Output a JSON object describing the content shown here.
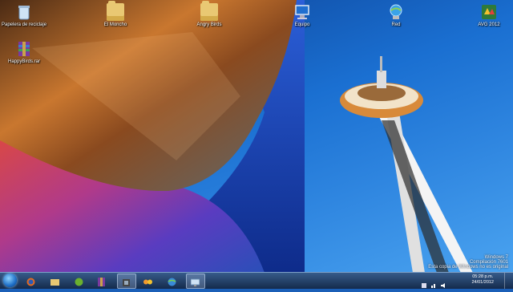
{
  "desktop": {
    "icons": [
      {
        "label": "Papelera de reciclaje",
        "icon": "recycle-bin-icon"
      },
      {
        "label": "El Moncho",
        "icon": "folder-icon"
      },
      {
        "label": "Angry Birds",
        "icon": "folder-icon"
      },
      {
        "label": "Equipo",
        "icon": "computer-icon"
      },
      {
        "label": "Red",
        "icon": "network-icon"
      },
      {
        "label": "AVG 2012",
        "icon": "avg-icon"
      },
      {
        "label": "HappyBirds.rar",
        "icon": "winrar-icon"
      }
    ],
    "watermark": {
      "line1": "Windows 7",
      "line2": "Compilación 7601",
      "line3": "Esta copia de Windows no es original"
    }
  },
  "taskbar": {
    "buttons": [
      "start-orb",
      "firefox",
      "explorer",
      "xbox-game",
      "winrar",
      "media-app",
      "games",
      "network-app",
      "remote-app"
    ],
    "clock": {
      "time": "05:28 p.m.",
      "date": "24/01/2012"
    },
    "colors": {
      "accent": "#1e6fc7"
    }
  }
}
